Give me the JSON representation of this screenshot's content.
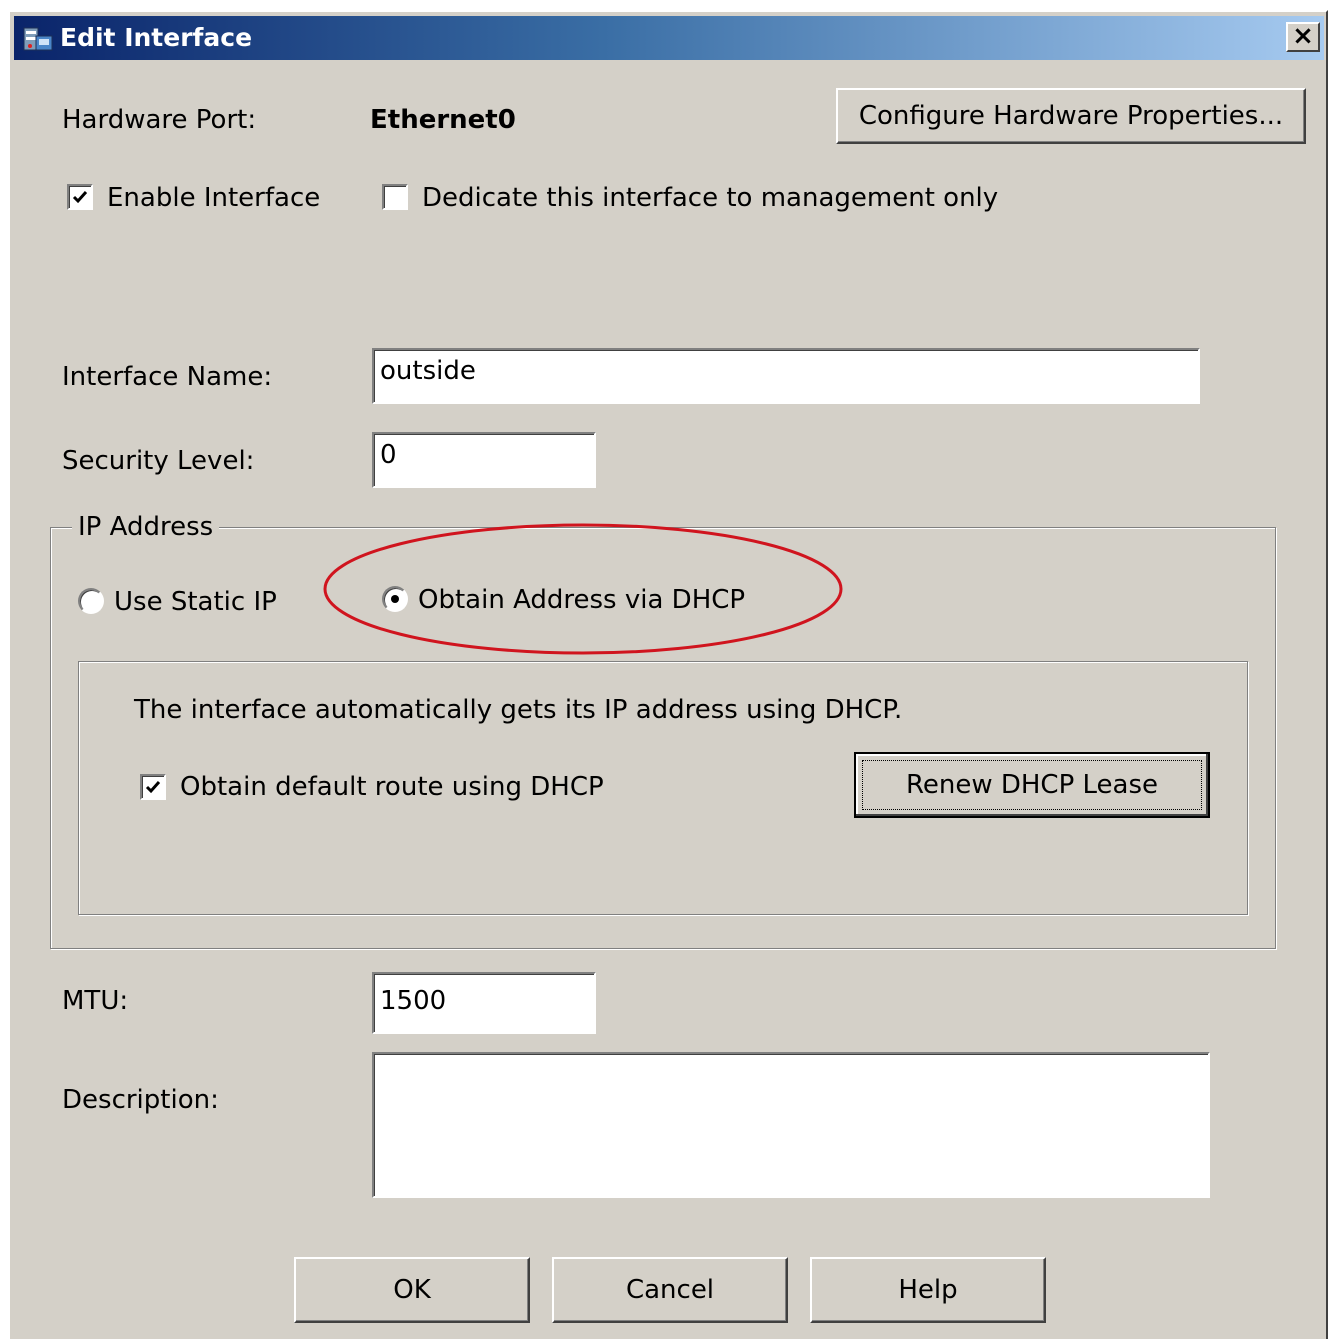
{
  "window": {
    "title": "Edit Interface",
    "close_glyph": "×"
  },
  "hardware": {
    "port_label": "Hardware Port:",
    "port_value": "Ethernet0",
    "configure_button": "Configure Hardware Properties..."
  },
  "options": {
    "enable_interface": {
      "label": "Enable Interface",
      "checked": true
    },
    "management_only": {
      "label": "Dedicate this interface to management only",
      "checked": false
    }
  },
  "form": {
    "interface_name_label": "Interface Name:",
    "interface_name_value": "outside",
    "security_level_label": "Security Level:",
    "security_level_value": "0",
    "mtu_label": "MTU:",
    "mtu_value": "1500",
    "description_label": "Description:",
    "description_value": ""
  },
  "ip_address": {
    "group_label": "IP Address",
    "static_radio": {
      "label": "Use Static IP",
      "selected": false
    },
    "dhcp_radio": {
      "label": "Obtain Address via DHCP",
      "selected": true
    },
    "dhcp_info": "The interface automatically gets its IP address using DHCP.",
    "default_route": {
      "label": "Obtain default route using DHCP",
      "checked": true
    },
    "renew_button": "Renew DHCP Lease"
  },
  "footer": {
    "ok": "OK",
    "cancel": "Cancel",
    "help": "Help"
  },
  "colors": {
    "dialog_bg": "#d4d0c8",
    "titlebar_start": "#0a246a",
    "titlebar_end": "#a6caf0",
    "annotation": "#d0141e"
  }
}
